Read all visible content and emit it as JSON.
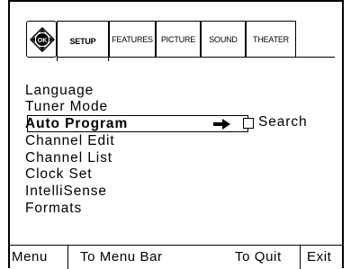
{
  "tabs": [
    {
      "label": "SETUP",
      "active": true
    },
    {
      "label": "FEATURES",
      "active": false
    },
    {
      "label": "PICTURE",
      "active": false
    },
    {
      "label": "SOUND",
      "active": false
    },
    {
      "label": "THEATER",
      "active": false
    }
  ],
  "ok_icon": {
    "label": "OK",
    "icon": "ok-dpad-icon"
  },
  "menu": {
    "items": [
      {
        "label": "Language"
      },
      {
        "label": "Tuner Mode"
      },
      {
        "label": "Auto Program",
        "selected": true
      },
      {
        "label": "Channel Edit"
      },
      {
        "label": "Channel List"
      },
      {
        "label": "Clock Set"
      },
      {
        "label": "IntelliSense"
      },
      {
        "label": "Formats"
      }
    ],
    "selected_arrow_icon": "right-arrow-icon",
    "option": {
      "label": "Search",
      "checked": false
    }
  },
  "bottom_bar": {
    "menu": "Menu",
    "to_menu_bar": "To Menu Bar",
    "to_quit": "To Quit",
    "exit": "Exit"
  }
}
